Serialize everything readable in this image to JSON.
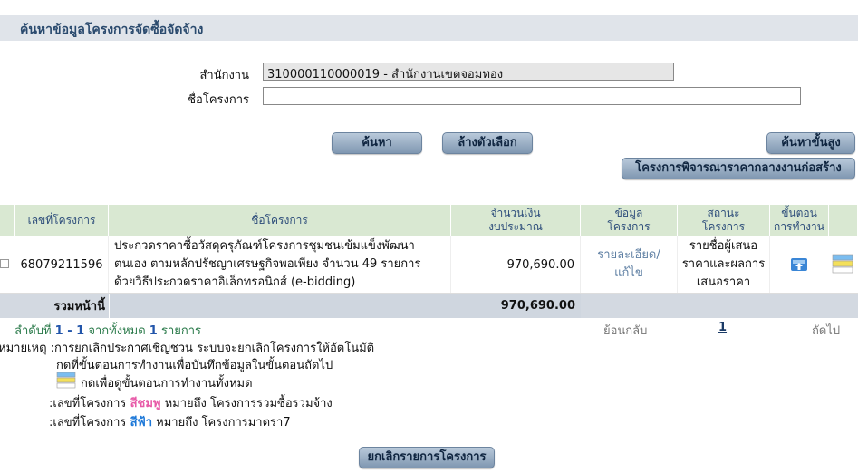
{
  "title": "ค้นหาข้อมูลโครงการจัดซื้อจัดจ้าง",
  "form": {
    "agency_label": "สำนักงาน",
    "agency_value": "310000110000019 - สำนักงานเขตจอมทอง",
    "project_label": "ชื่อโครงการ",
    "project_value": ""
  },
  "buttons": {
    "search": "ค้นหา",
    "clear": "ล้างตัวเลือก",
    "advanced": "ค้นหาขั้นสูง",
    "pre_construction": "โครงการพิจารณาราคากลางงานก่อสร้าง",
    "cancel_project": "ยกเลิกรายการโครงการ"
  },
  "table": {
    "headers": {
      "project_no": "เลขที่โครงการ",
      "project_name": "ชื่อโครงการ",
      "budget_line1": "จำนวนเงิน",
      "budget_line2": "งบประมาณ",
      "info_line1": "ข้อมูล",
      "info_line2": "โครงการ",
      "status_line1": "สถานะ",
      "status_line2": "โครงการ",
      "step_line1": "ขั้นตอน",
      "step_line2": "การทำงาน"
    },
    "rows": [
      {
        "project_no": "68079211596",
        "project_name": "ประกวดราคาซื้อวัสดุครุภัณฑ์โครงการชุมชนเข้มแข็งพัฒนาตนเอง ตามหลักปรัชญาเศรษฐกิจพอเพียง จำนวน 49 รายการ ด้วยวิธีประกวดราคาอิเล็กทรอนิกส์ (e-bidding)",
        "budget": "970,690.00",
        "info_link": "รายละเอียด/แก้ไข",
        "status": "รายชื่อผู้เสนอราคาและผลการเสนอราคา",
        "step_icon": "cloud-upload-icon",
        "detail_icon": "steps-list-icon"
      }
    ],
    "summary_label": "รวมหน้านี้",
    "summary_value": "970,690.00"
  },
  "pagination": {
    "seq_prefix": "ลำดับที่",
    "range": "1 - 1",
    "from_total": "จากทั้งหมด",
    "total": "1",
    "items_word": "รายการ",
    "back": "ย้อนกลับ",
    "page": "1",
    "next": "ถัดไป"
  },
  "notes": {
    "line1": "หมายเหตุ :การยกเลิกประกาศเชิญชวน ระบบจะยกเลิกโครงการให้อัตโนมัติ",
    "line2": "กดที่ขั้นตอนการทำงานเพื่อบันทึกข้อมูลในขั้นตอนถัดไป",
    "line3": "กดเพื่อดูขั้นตอนการทำงานทั้งหมด",
    "line4_prefix": ":เลขที่โครงการ",
    "line4_color": "สีชมพู",
    "line4_suffix": "หมายถึง โครงการรวมซื้อรวมจ้าง",
    "line5_prefix": ":เลขที่โครงการ",
    "line5_color": "สีฟ้า",
    "line5_suffix": "หมายถึง โครงการมาตรา7"
  },
  "colors": {
    "header_bg": "#d9e8d2",
    "title_text": "#2a4a6e",
    "pink": "#e85aa8",
    "sky": "#1d78d8"
  }
}
